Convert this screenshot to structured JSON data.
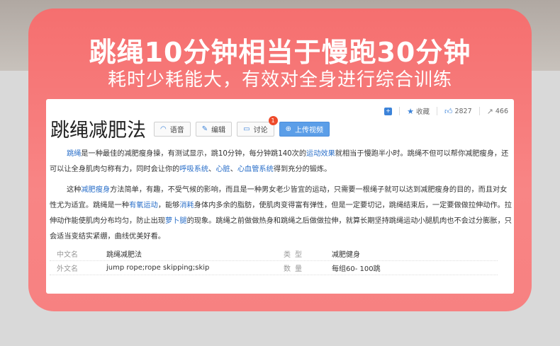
{
  "banner": {
    "headline": "跳绳10分钟相当于慢跑30分钟",
    "subline": "耗时少耗能大，有效对全身进行综合训练"
  },
  "toolbar": {
    "collect_label": "收藏",
    "like_count": "2827",
    "share_count": "466"
  },
  "article": {
    "title": "跳绳减肥法",
    "buttons": {
      "voice": "语音",
      "edit": "编辑",
      "discuss": "讨论",
      "discuss_badge": "1",
      "upload_video": "上传视频"
    },
    "p1": {
      "s1_link": "跳绳",
      "s2": "是一种最佳的减肥瘦身操，有测试显示，跳10分钟，每分钟跳140次的",
      "s3_link": "运动效果",
      "s4": "就相当于慢跑半小时。跳绳不但可以帮你减肥瘦身，还可以让全身肌肉匀称有力，同时会让你的",
      "s5_link": "呼吸系统",
      "s6": "、",
      "s7_link": "心脏",
      "s8": "、",
      "s9_link": "心血管系统",
      "s10": "得到充分的锻炼。"
    },
    "p2": {
      "s1": "这种",
      "s2_link": "减肥瘦身",
      "s3": "方法简单，有趣，不受气候的影响，而且是一种男女老少皆宜的运动，只需要一根绳子就可以达到减肥瘦身的目的，而且对女性尤为适宜。跳绳是一种",
      "s4_link": "有氧运动",
      "s5": "，能够",
      "s6_link": "消耗",
      "s7": "身体内多余的脂肪，使肌肉变得富有弹性，但是一定要切记，跳绳结束后，一定要做做拉伸动作。拉伸动作能使肌肉分布均匀，防止出现",
      "s8_link": "萝卜腿",
      "s9": "的现象。跳绳之前做做热身和跳绳之后做做拉伸，就算长期坚持跳绳运动小腿肌肉也不会过分膨胀，只会适当变结实紧绷，曲线优美好看。"
    },
    "info": [
      {
        "k1": "中文名",
        "v1": "跳绳减肥法",
        "k2": "类型",
        "v2": "减肥健身"
      },
      {
        "k1": "外文名",
        "v1": "jump rope;rope skipping;skip",
        "k2": "数量",
        "v2": "每组60- 100跳"
      }
    ]
  }
}
